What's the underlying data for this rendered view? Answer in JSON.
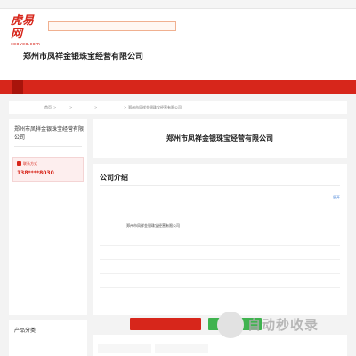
{
  "topbar": {
    "welcome": ""
  },
  "header": {
    "logo_main": "虎易网",
    "logo_sub": "cooveo.com",
    "ad_text": "",
    "company_name": "郑州市凤祥金银珠宝经营有限公司",
    "company_subline": ""
  },
  "nav": {
    "home": ""
  },
  "breadcrumb": {
    "label": "",
    "items": [
      "首页",
      "",
      "",
      ""
    ],
    "current": "郑州市凤祥金银珠宝经营有限公司",
    "update_time": ""
  },
  "sidebar": {
    "title": "郑州市凤祥金银珠宝经营有限公司",
    "contact_label": "联系方式",
    "phone": "138****8030",
    "fields": [
      {
        "key": "",
        "value": ""
      },
      {
        "key": "",
        "value": ""
      },
      {
        "key": "",
        "value": ""
      },
      {
        "key": "",
        "value": ""
      },
      {
        "key": "",
        "value": ""
      },
      {
        "key": "",
        "value": ""
      }
    ],
    "product_title": "产品分类"
  },
  "main": {
    "title": "郑州市凤祥金银珠宝经营有限公司",
    "intro_title": "公司介绍",
    "intro_text": "",
    "expand_label": "展开",
    "info_rows": [
      {
        "key": "",
        "value": "郑州市凤祥金银珠宝经营有限公司"
      },
      {
        "key": "",
        "value": ""
      },
      {
        "key": "",
        "value": ""
      },
      {
        "key": "",
        "value": ""
      },
      {
        "key": "",
        "value": ""
      }
    ]
  },
  "actions": {
    "contact_button": "",
    "wechat_button": ""
  },
  "stats": {
    "title": "",
    "items": [
      {
        "num": "",
        "label": ""
      },
      {
        "num": "",
        "label": ""
      }
    ]
  },
  "watermark": {
    "main": "自动秒收录",
    "sub": ""
  },
  "colors": {
    "brand_red": "#d7261b",
    "wechat_green": "#3fb34f",
    "link_blue": "#3a7bd5"
  }
}
